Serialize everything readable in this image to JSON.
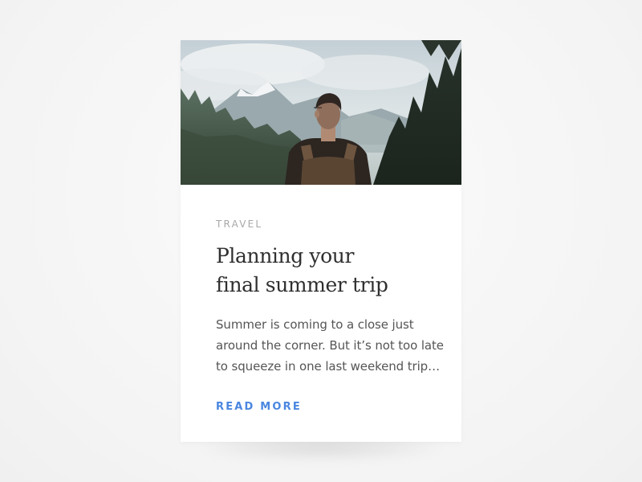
{
  "card": {
    "category": "TRAVEL",
    "title_lines": [
      "Planning your",
      "final summer trip"
    ],
    "excerpt_lines": [
      "Summer is coming to a close just",
      "around the corner. But it’s not too late",
      "to squeeze in one last weekend trip…"
    ],
    "read_more_label": "READ MORE"
  },
  "colors": {
    "accent": "#4a86e0",
    "category_text": "#a8a8a8",
    "title_text": "#2f2f2f",
    "body_text": "#555555",
    "card_bg": "#ffffff",
    "page_bg": "#f6f6f6"
  },
  "hero_image": {
    "icon": "hero-photo-hiker-mountains"
  }
}
